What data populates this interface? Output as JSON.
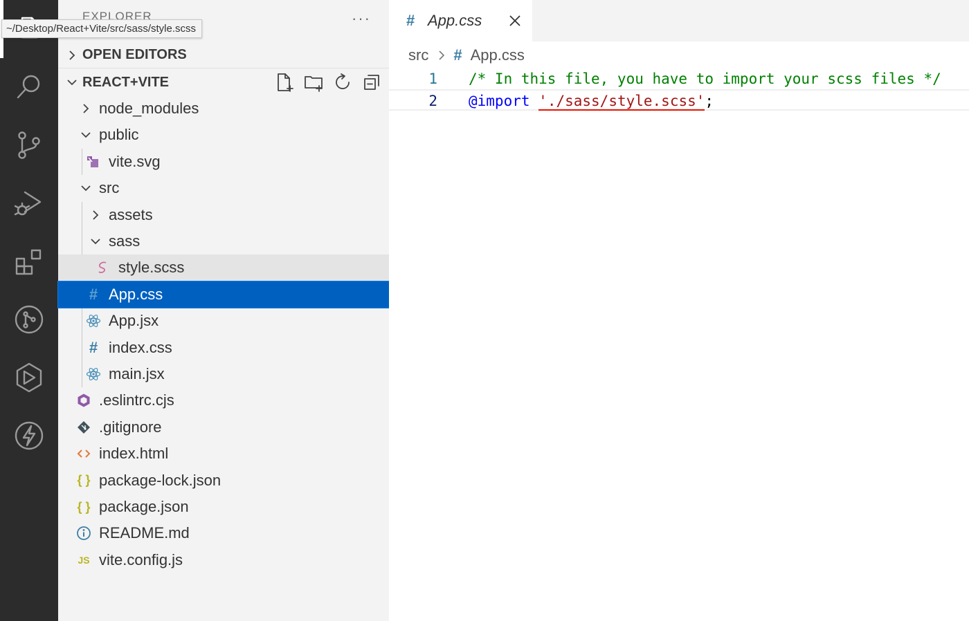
{
  "tooltip": "~/Desktop/React+Vite/src/sass/style.scss",
  "sidebar": {
    "title": "EXPLORER",
    "more": "···",
    "open_editors": "OPEN EDITORS",
    "project": "REACT+VITE"
  },
  "tree": {
    "node_modules": "node_modules",
    "public": "public",
    "vite_svg": "vite.svg",
    "src": "src",
    "assets": "assets",
    "sass": "sass",
    "style_scss": "style.scss",
    "app_css": "App.css",
    "app_jsx": "App.jsx",
    "index_css": "index.css",
    "main_jsx": "main.jsx",
    "eslintrc": ".eslintrc.cjs",
    "gitignore": ".gitignore",
    "index_html": "index.html",
    "package_lock": "package-lock.json",
    "package_json": "package.json",
    "readme": "README.md",
    "vite_config": "vite.config.js"
  },
  "icons": {
    "hash": "#",
    "json": "{ }",
    "js": "JS",
    "html": "<>"
  },
  "editor": {
    "tab_label": "App.css",
    "breadcrumb": {
      "folder": "src",
      "file": "App.css"
    },
    "lines": [
      {
        "number": "1",
        "comment": "/* In this file, you have to import your scss files */"
      },
      {
        "number": "2",
        "keyword": "@import",
        "string": "'./sass/style.scss'",
        "punct": ";"
      }
    ]
  },
  "colors": {
    "activity_bar": "#2c2c2c",
    "sidebar": "#f3f3f3",
    "selection": "#0060c0",
    "css_icon": "#3c7ea5",
    "react_icon": "#4a90b8",
    "scss_icon": "#cd6799",
    "json_icon": "#b9b522",
    "html_icon": "#e37933"
  }
}
